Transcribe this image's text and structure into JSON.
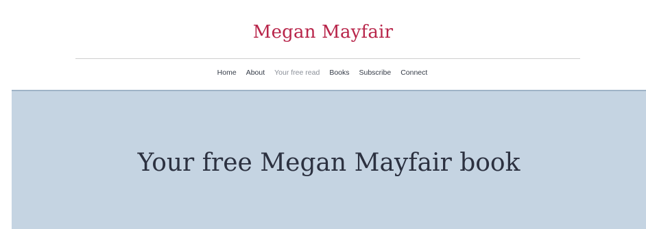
{
  "header": {
    "site_title": "Megan Mayfair"
  },
  "nav": {
    "items": [
      {
        "label": "Home"
      },
      {
        "label": "About"
      },
      {
        "label": "Your free read"
      },
      {
        "label": "Books"
      },
      {
        "label": "Subscribe"
      },
      {
        "label": "Connect"
      }
    ]
  },
  "hero": {
    "title": "Your free Megan Mayfair book"
  },
  "colors": {
    "brand": "#b8254a",
    "hero_background": "#c5d4e2",
    "text_dark": "#2c3140"
  }
}
